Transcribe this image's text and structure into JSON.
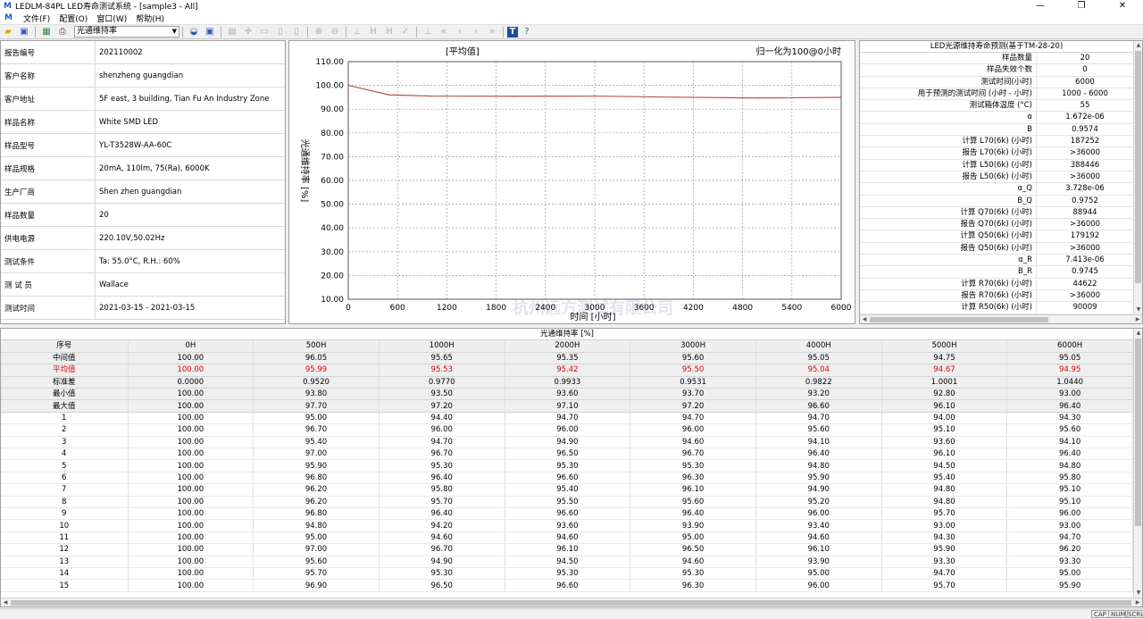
{
  "window": {
    "title": "LEDLM-84PL LED寿命测试系统 - [sample3 - All]",
    "min": "—",
    "max": "❐",
    "close": "✕"
  },
  "menu": [
    "文件(F)",
    "配置(O)",
    "窗口(W)",
    "帮助(H)"
  ],
  "toolbar": {
    "select_value": "光通维持率"
  },
  "info": [
    {
      "label": "报告编号",
      "value": "202110002"
    },
    {
      "label": "客户名称",
      "value": "shenzheng guangdian"
    },
    {
      "label": "客户地址",
      "value": "5F east, 3 building, Tian Fu An Industry Zone"
    },
    {
      "label": "样品名称",
      "value": "White SMD LED"
    },
    {
      "label": "样品型号",
      "value": "YL-T3528W-AA-60C"
    },
    {
      "label": "样品规格",
      "value": "20mA, 110lm, 75(Ra), 6000K"
    },
    {
      "label": "生产厂商",
      "value": "Shen zhen guangdian"
    },
    {
      "label": "样品数量",
      "value": "20"
    },
    {
      "label": "供电电源",
      "value": "220.10V,50.02Hz"
    },
    {
      "label": "测试条件",
      "value": "Ta: 55.0°C, R.H.: 60%"
    },
    {
      "label": "测 试 员",
      "value": "Wallace"
    },
    {
      "label": "测试时间",
      "value": "2021-03-15 - 2021-03-15"
    }
  ],
  "chart_data": {
    "type": "line",
    "title": "[平均值]",
    "subtitle": "归一化为100@0小时",
    "xlabel": "时间 [小时]",
    "ylabel": "光通维持率 [%]",
    "x": [
      0,
      500,
      1000,
      2000,
      3000,
      4000,
      5000,
      6000
    ],
    "series": [
      {
        "values": [
          100.0,
          95.99,
          95.53,
          95.42,
          95.5,
          95.04,
          94.67,
          94.95
        ]
      }
    ],
    "xlim": [
      0,
      6000
    ],
    "ylim": [
      10,
      110
    ],
    "xticks": [
      "0",
      "600",
      "1200",
      "1800",
      "2400",
      "3000",
      "3600",
      "4200",
      "4800",
      "5400",
      "6000"
    ],
    "yticks": [
      "10.00",
      "20.00",
      "30.00",
      "40.00",
      "50.00",
      "60.00",
      "70.00",
      "80.00",
      "90.00",
      "100.00",
      "110.00"
    ],
    "line_color": "#c0504d",
    "grid": true,
    "watermark": "杭州远方测试有限公司"
  },
  "prediction": {
    "title": "LED光源维持寿命预测(基于TM-28-20)",
    "rows": [
      {
        "label": "样品数量",
        "value": "20"
      },
      {
        "label": "样品失效个数",
        "value": "0"
      },
      {
        "label": "测试时间(小时)",
        "value": "6000"
      },
      {
        "label": "用于预测的测试时间 (小时 - 小时)",
        "value": "1000 - 6000"
      },
      {
        "label": "测试箱体温度 (°C)",
        "value": "55"
      },
      {
        "label": "α",
        "value": "1.672e-06"
      },
      {
        "label": "B",
        "value": "0.9574"
      },
      {
        "label": "计算 L70(6k) (小时)",
        "value": "187252"
      },
      {
        "label": "报告 L70(6k) (小时)",
        "value": ">36000"
      },
      {
        "label": "计算 L50(6k) (小时)",
        "value": "388446"
      },
      {
        "label": "报告 L50(6k) (小时)",
        "value": ">36000"
      },
      {
        "label": "α_Q",
        "value": "3.728e-06"
      },
      {
        "label": "B_Q",
        "value": "0.9752"
      },
      {
        "label": "计算 Q70(6k) (小时)",
        "value": "88944"
      },
      {
        "label": "报告 Q70(6k) (小时)",
        "value": ">36000"
      },
      {
        "label": "计算 Q50(6k) (小时)",
        "value": "179192"
      },
      {
        "label": "报告 Q50(6k) (小时)",
        "value": ">36000"
      },
      {
        "label": "α_R",
        "value": "7.413e-06"
      },
      {
        "label": "B_R",
        "value": "0.9745"
      },
      {
        "label": "计算 R70(6k) (小时)",
        "value": "44622"
      },
      {
        "label": "报告 R70(6k) (小时)",
        "value": ">36000"
      },
      {
        "label": "计算 R50(6k) (小时)",
        "value": "90009"
      }
    ]
  },
  "grid": {
    "title": "光通维持率 [%]",
    "columns": [
      "序号",
      "0H",
      "500H",
      "1000H",
      "2000H",
      "3000H",
      "4000H",
      "5000H",
      "6000H"
    ],
    "stats": [
      {
        "cells": [
          "中间值",
          "100.00",
          "96.05",
          "95.65",
          "95.35",
          "95.60",
          "95.05",
          "94.75",
          "95.05"
        ],
        "red": false
      },
      {
        "cells": [
          "平均值",
          "100.00",
          "95.99",
          "95.53",
          "95.42",
          "95.50",
          "95.04",
          "94.67",
          "94.95"
        ],
        "red": true
      },
      {
        "cells": [
          "标准差",
          "0.0000",
          "0.9520",
          "0.9770",
          "0.9933",
          "0.9531",
          "0.9822",
          "1.0001",
          "1.0440"
        ],
        "red": false
      },
      {
        "cells": [
          "最小值",
          "100.00",
          "93.80",
          "93.50",
          "93.60",
          "93.70",
          "93.20",
          "92.80",
          "93.00"
        ],
        "red": false
      },
      {
        "cells": [
          "最大值",
          "100.00",
          "97.70",
          "97.20",
          "97.10",
          "97.20",
          "96.60",
          "96.10",
          "96.40"
        ],
        "red": false
      }
    ],
    "rows": [
      [
        "1",
        "100.00",
        "95.00",
        "94.40",
        "94.70",
        "94.70",
        "94.70",
        "94.00",
        "94.30"
      ],
      [
        "2",
        "100.00",
        "96.70",
        "96.00",
        "96.00",
        "96.00",
        "95.60",
        "95.10",
        "95.60"
      ],
      [
        "3",
        "100.00",
        "95.40",
        "94.70",
        "94.90",
        "94.60",
        "94.10",
        "93.60",
        "94.10"
      ],
      [
        "4",
        "100.00",
        "97.00",
        "96.70",
        "96.50",
        "96.70",
        "96.40",
        "96.10",
        "96.40"
      ],
      [
        "5",
        "100.00",
        "95.90",
        "95.30",
        "95.30",
        "95.30",
        "94.80",
        "94.50",
        "94.80"
      ],
      [
        "6",
        "100.00",
        "96.80",
        "96.40",
        "96.60",
        "96.30",
        "95.90",
        "95.40",
        "95.80"
      ],
      [
        "7",
        "100.00",
        "96.20",
        "95.80",
        "95.40",
        "96.10",
        "94.90",
        "94.80",
        "95.10"
      ],
      [
        "8",
        "100.00",
        "96.20",
        "95.70",
        "95.50",
        "95.60",
        "95.20",
        "94.80",
        "95.10"
      ],
      [
        "9",
        "100.00",
        "96.80",
        "96.40",
        "96.60",
        "96.40",
        "96.00",
        "95.70",
        "96.00"
      ],
      [
        "10",
        "100.00",
        "94.80",
        "94.20",
        "93.60",
        "93.90",
        "93.40",
        "93.00",
        "93.00"
      ],
      [
        "11",
        "100.00",
        "95.00",
        "94.60",
        "94.60",
        "95.00",
        "94.60",
        "94.30",
        "94.70"
      ],
      [
        "12",
        "100.00",
        "97.00",
        "96.70",
        "96.10",
        "96.50",
        "96.10",
        "95.90",
        "96.20"
      ],
      [
        "13",
        "100.00",
        "95.60",
        "94.90",
        "94.50",
        "94.60",
        "93.90",
        "93.30",
        "93.30"
      ],
      [
        "14",
        "100.00",
        "95.70",
        "95.30",
        "95.30",
        "95.30",
        "95.00",
        "94.70",
        "95.00"
      ],
      [
        "15",
        "100.00",
        "96.90",
        "96.50",
        "96.60",
        "96.30",
        "96.00",
        "95.70",
        "95.90"
      ]
    ]
  },
  "status": [
    "CAP",
    "NUM",
    "SCRL"
  ]
}
